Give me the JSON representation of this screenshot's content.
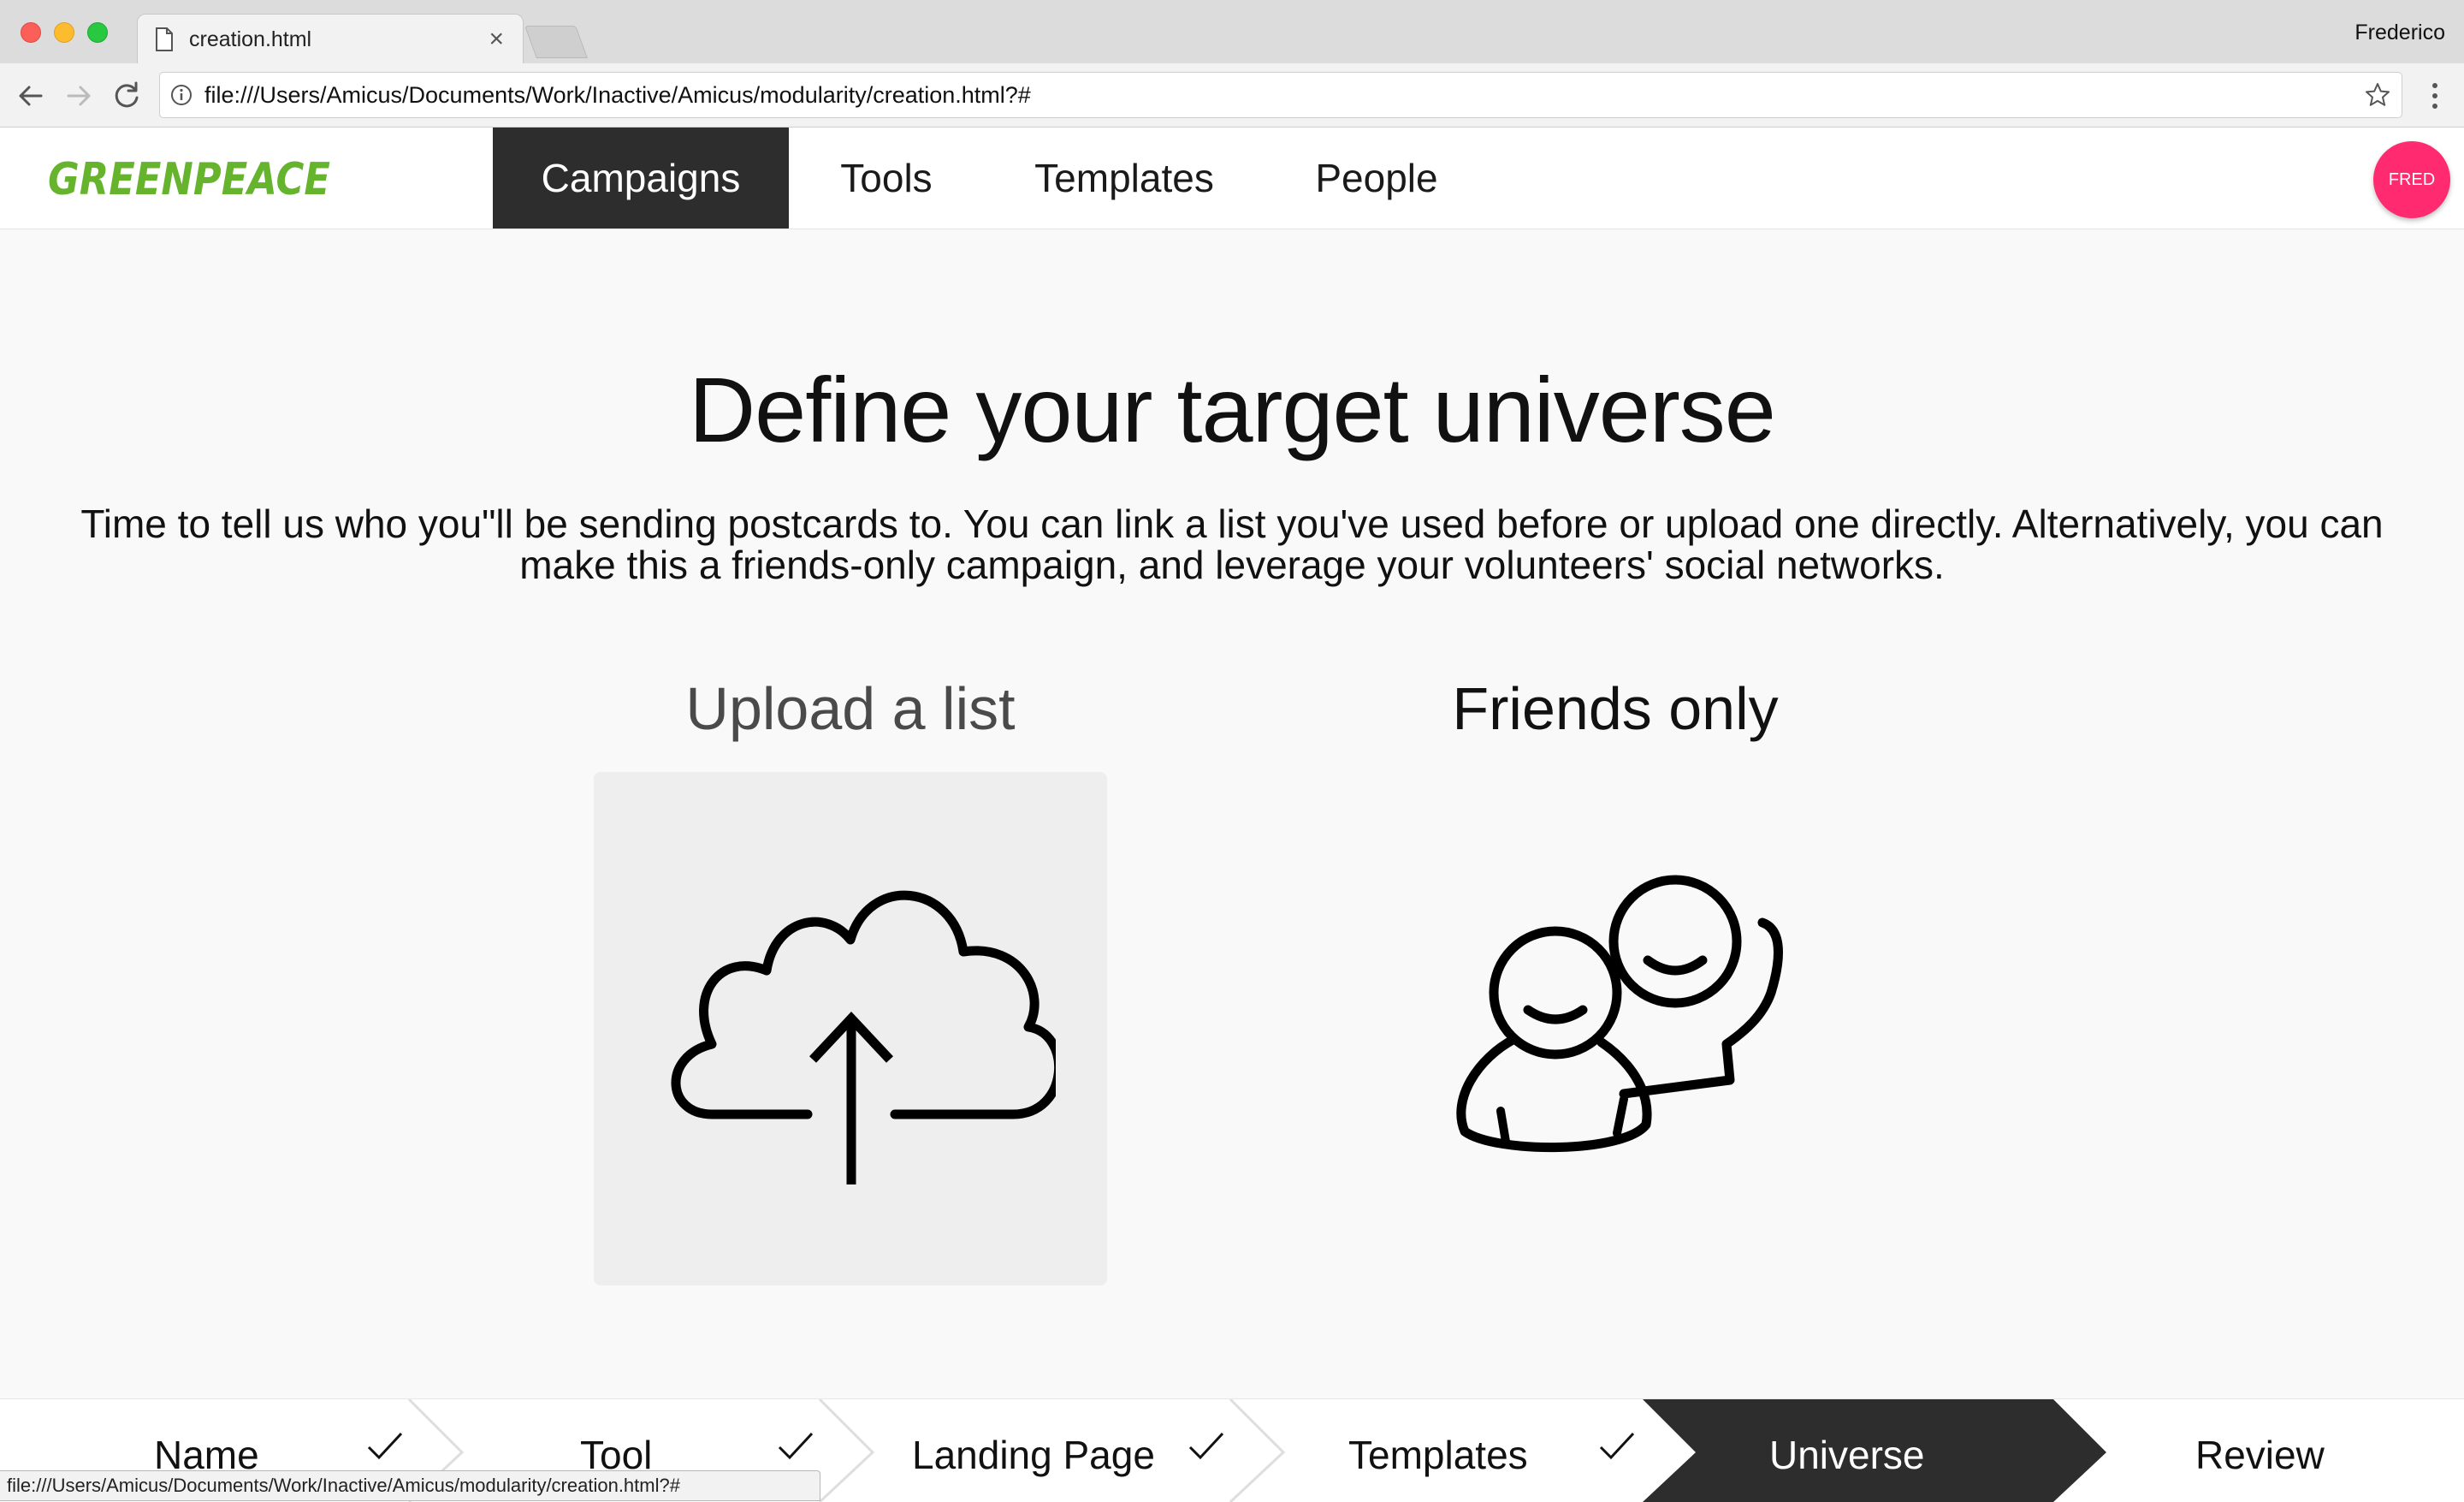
{
  "browser": {
    "tab_title": "creation.html",
    "tab_close": "×",
    "profile_name": "Frederico",
    "url": "file:///Users/Amicus/Documents/Work/Inactive/Amicus/modularity/creation.html?#",
    "status_url": "file:///Users/Amicus/Documents/Work/Inactive/Amicus/modularity/creation.html?#"
  },
  "header": {
    "logo_text": "GREENPEACE",
    "logo_color": "#66b32e",
    "nav": [
      {
        "label": "Campaigns",
        "active": true
      },
      {
        "label": "Tools",
        "active": false
      },
      {
        "label": "Templates",
        "active": false
      },
      {
        "label": "People",
        "active": false
      }
    ],
    "avatar_label": "FRED",
    "avatar_color": "#ff2a70"
  },
  "main": {
    "title": "Define your target universe",
    "description": "Time to tell us who you\"ll be sending postcards to. You can link a list you've used before or upload one directly. Alternatively, you can make this a friends-only campaign, and leverage your volunteers' social networks.",
    "options": [
      {
        "label": "Upload a list",
        "icon": "cloud-upload-icon"
      },
      {
        "label": "Friends only",
        "icon": "friends-icon"
      }
    ]
  },
  "stepper": {
    "active_color": "#2d2d2d",
    "steps": [
      {
        "label": "Name",
        "done": true
      },
      {
        "label": "Tool",
        "done": true
      },
      {
        "label": "Landing Page",
        "done": true
      },
      {
        "label": "Templates",
        "done": true
      },
      {
        "label": "Universe",
        "done": false,
        "active": true
      },
      {
        "label": "Review",
        "done": false
      }
    ]
  }
}
